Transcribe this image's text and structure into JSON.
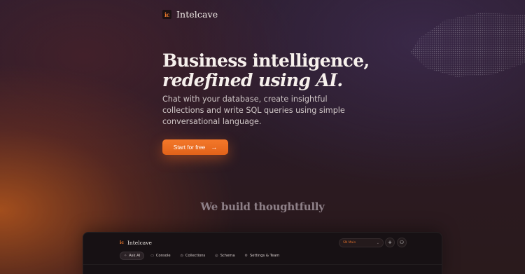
{
  "header": {
    "logo_text": "ic",
    "brand_name": "Intelcave"
  },
  "hero": {
    "title_line1": "Business intelligence,",
    "title_line2": "redefined using AI.",
    "subtitle": "Chat with your database, create insightful collections and write SQL queries using simple conversational language.",
    "cta_label": "Start for free",
    "cta_icon": "→"
  },
  "section": {
    "tagline": "We build thoughtfully"
  },
  "app_preview": {
    "logo_text": "ic",
    "brand_name": "Intelcave",
    "db_selector": {
      "selected": "SN Main",
      "chevron": "⌄"
    },
    "add_icon": "+",
    "user_icon": "⚇",
    "tabs": [
      {
        "label": "Ask AI",
        "icon": "✧",
        "active": true
      },
      {
        "label": "Console",
        "icon": "▭",
        "active": false
      },
      {
        "label": "Collections",
        "icon": "◷",
        "active": false
      },
      {
        "label": "Schema",
        "icon": "◎",
        "active": false
      },
      {
        "label": "Settings & Team",
        "icon": "⚙",
        "active": false
      }
    ]
  },
  "colors": {
    "accent": "#f07a2c",
    "cta_bg": "#e8681f",
    "bg_dark": "#2a1b27"
  }
}
